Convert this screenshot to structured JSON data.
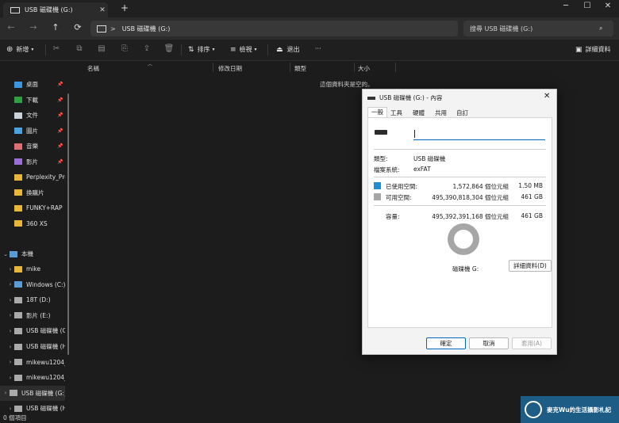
{
  "window": {
    "tab_title": "USB 磁碟機 (G:)",
    "tab_close": "✕",
    "new_tab": "+",
    "minimize": "─",
    "maximize": "☐",
    "close": "✕"
  },
  "nav": {
    "back": "←",
    "forward": "→",
    "up": "↑",
    "refresh": "⟳",
    "path_sep": ">",
    "path": "USB 磁碟機 (G:)",
    "search_placeholder": "搜尋 USB 磁碟機 (G:)",
    "search_icon": "⌕"
  },
  "toolbar": {
    "new_label": "新增",
    "sort_label": "排序",
    "view_label": "檢視",
    "eject_label": "退出",
    "more_label": "···",
    "details_label": "詳細資料"
  },
  "sidebar": {
    "quick": [
      {
        "label": "桌面",
        "color": "#3a96dd",
        "pinned": true
      },
      {
        "label": "下載",
        "color": "#2ea043",
        "pinned": true
      },
      {
        "label": "文件",
        "color": "#c9d1d9",
        "pinned": true
      },
      {
        "label": "圖片",
        "color": "#4aa3df",
        "pinned": true
      },
      {
        "label": "音樂",
        "color": "#e06c75",
        "pinned": true
      },
      {
        "label": "影片",
        "color": "#9a6fd6",
        "pinned": true
      },
      {
        "label": "Perplexity_Pro",
        "color": "#e8b73a",
        "pinned": false
      },
      {
        "label": "換購片",
        "color": "#e8b73a",
        "pinned": false
      },
      {
        "label": "FUNKY+RAP",
        "color": "#e8b73a",
        "pinned": false
      },
      {
        "label": "360 XS",
        "color": "#e8b73a",
        "pinned": false
      }
    ],
    "pin_icon": "📌",
    "this_pc": "本機",
    "drives": [
      {
        "label": "mike",
        "color": "#e8b73a"
      },
      {
        "label": "Windows (C:)",
        "color": "#5a9bd5"
      },
      {
        "label": "18T (D:)",
        "color": "#aaaaaa"
      },
      {
        "label": "影片 (E:)",
        "color": "#aaaaaa"
      },
      {
        "label": "USB 磁碟機 (G:)",
        "color": "#aaaaaa"
      },
      {
        "label": "USB 磁碟機 (H:)",
        "color": "#aaaaaa"
      },
      {
        "label": "mikewu1204_",
        "color": "#aaaaaa"
      },
      {
        "label": "mikewu1204_",
        "color": "#aaaaaa"
      },
      {
        "label": "USB 磁碟機 (G:)",
        "color": "#aaaaaa"
      },
      {
        "label": "USB 磁碟機 (H:)",
        "color": "#aaaaaa"
      }
    ]
  },
  "columns": {
    "name": "名稱",
    "modified": "修改日期",
    "type": "類型",
    "size": "大小"
  },
  "empty_message": "這個資料夾是空的。",
  "status": "0 個項目",
  "dialog": {
    "title": "USB 磁碟機 (G:) - 內容",
    "close": "✕",
    "tabs": [
      "一般",
      "工具",
      "硬體",
      "共用",
      "自訂"
    ],
    "type_label": "類型:",
    "type_value": "USB 磁碟機",
    "fs_label": "檔案系統:",
    "fs_value": "exFAT",
    "used_label": "已使用空間:",
    "used_bytes": "1,572,864 個位元組",
    "used_size": "1.50 MB",
    "free_label": "可用空間:",
    "free_bytes": "495,390,818,304 個位元組",
    "free_size": "461 GB",
    "cap_label": "容量:",
    "cap_bytes": "495,392,391,168 個位元組",
    "cap_size": "461 GB",
    "drive_label": "磁碟機 G:",
    "details_btn": "詳細資料(D)",
    "ok": "確定",
    "cancel": "取消",
    "apply": "套用(A)",
    "used_color": "#1a8fd3",
    "free_color": "#a6a6a6"
  },
  "watermark": "麥克Wu的生活攝影札記"
}
